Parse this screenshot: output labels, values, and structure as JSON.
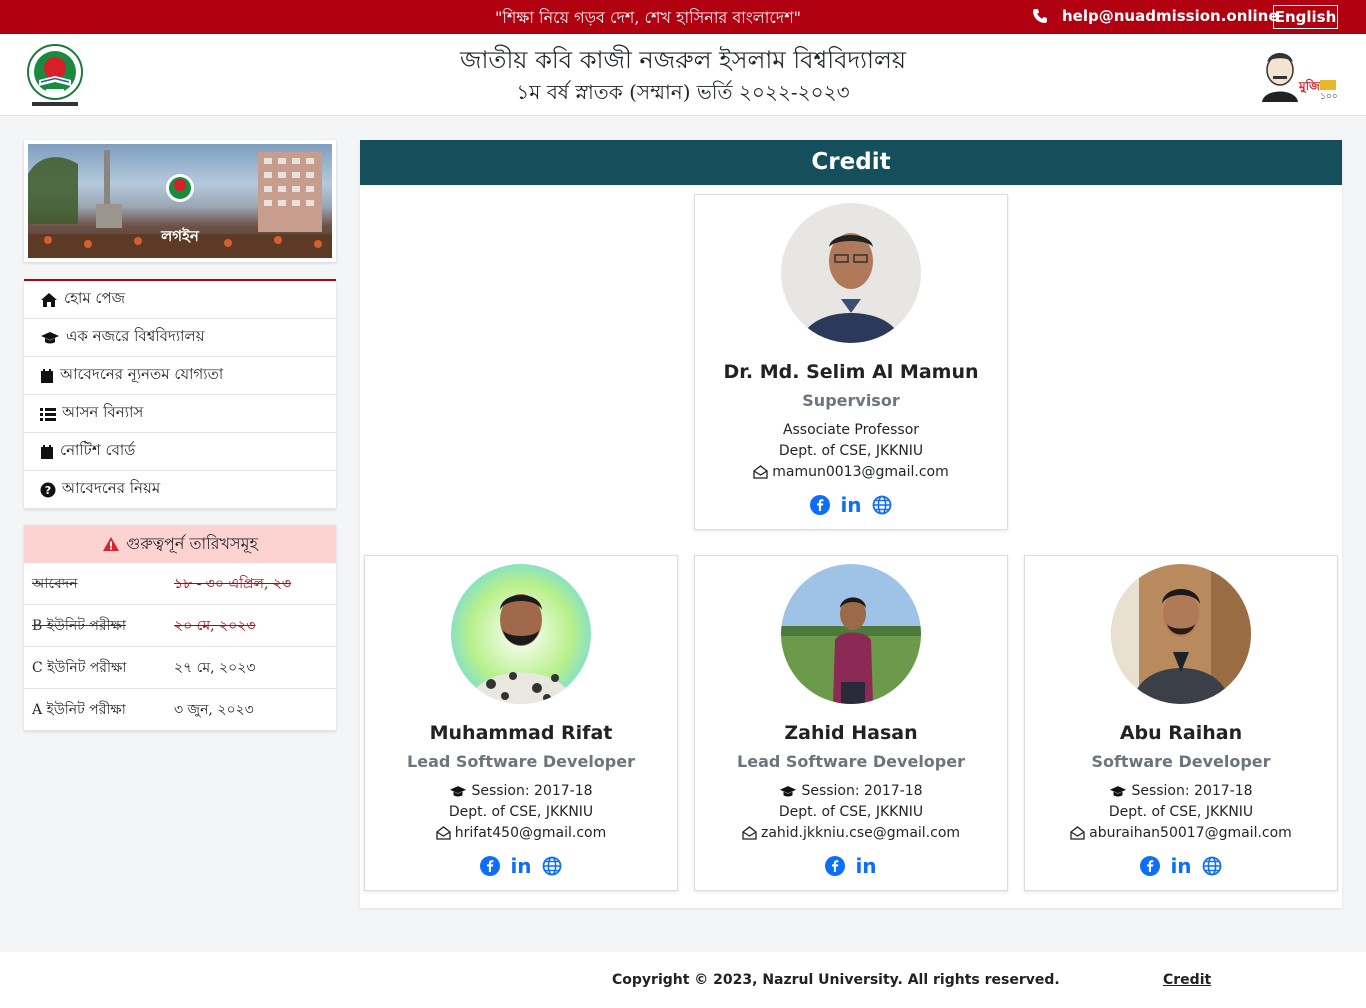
{
  "topbar": {
    "slogan": "\"শিক্ষা নিয়ে গড়ব দেশ, শেখ হাসিনার বাংলাদেশ\"",
    "email": "help@nuadmission.online",
    "language": "English"
  },
  "header": {
    "title": "জাতীয় কবি কাজী নজরুল ইসলাম বিশ্ববিদ্যালয়",
    "subtitle": "১ম বর্ষ স্নাতক (সম্মান) ভর্তি ২০২২-২০২৩"
  },
  "sidebar": {
    "login_label": "লগইন",
    "menu": [
      {
        "label": "হোম পেজ",
        "icon": "home-icon"
      },
      {
        "label": "এক নজরে বিশ্ববিদ্যালয়",
        "icon": "graduation-cap-icon"
      },
      {
        "label": "আবেদনের ন্যূনতম যোগ্যতা",
        "icon": "calendar-icon"
      },
      {
        "label": "আসন বিন্যাস",
        "icon": "list-icon"
      },
      {
        "label": "নোটিশ বোর্ড",
        "icon": "calendar-icon"
      },
      {
        "label": "আবেদনের নিয়ম",
        "icon": "question-circle-icon"
      }
    ],
    "dates_title": "গুরুত্বপূর্ন তারিখসমূহ",
    "dates": [
      {
        "name": "আবেদন",
        "date": "১৮ - ৩০ এপ্রিল, ২৩",
        "past": true
      },
      {
        "name": "B ইউনিট পরীক্ষা",
        "date": "২০ মে, ২০২৩",
        "past": true
      },
      {
        "name": "C ইউনিট পরীক্ষা",
        "date": "২৭ মে, ২০২৩",
        "past": false
      },
      {
        "name": "A ইউনিট পরীক্ষা",
        "date": "৩ জুন, ২০২৩",
        "past": false
      }
    ]
  },
  "credit": {
    "title": "Credit",
    "supervisor": {
      "name": "Dr. Md. Selim Al Mamun",
      "role": "Supervisor",
      "position": "Associate Professor",
      "dept": "Dept. of CSE, JKKNIU",
      "email": "mamun0013@gmail.com"
    },
    "developers": [
      {
        "name": "Muhammad Rifat",
        "role": "Lead Software Developer",
        "session": "Session: 2017-18",
        "dept": "Dept. of CSE, JKKNIU",
        "email": "hrifat450@gmail.com",
        "website": true
      },
      {
        "name": "Zahid Hasan",
        "role": "Lead Software Developer",
        "session": "Session: 2017-18",
        "dept": "Dept. of CSE, JKKNIU",
        "email": "zahid.jkkniu.cse@gmail.com",
        "website": false
      },
      {
        "name": "Abu Raihan",
        "role": "Software Developer",
        "session": "Session: 2017-18",
        "dept": "Dept. of CSE, JKKNIU",
        "email": "aburaihan50017@gmail.com",
        "website": true
      }
    ],
    "linkedin_label": "in"
  },
  "footer": {
    "copyright": "Copyright © 2023, Nazrul University. All rights reserved.",
    "credit_link": "Credit"
  },
  "colors": {
    "brand_red": "#b1000f",
    "panel_header": "#164f5c",
    "link_blue": "#0d6efd",
    "dates_header_bg": "#fcd3d1"
  }
}
